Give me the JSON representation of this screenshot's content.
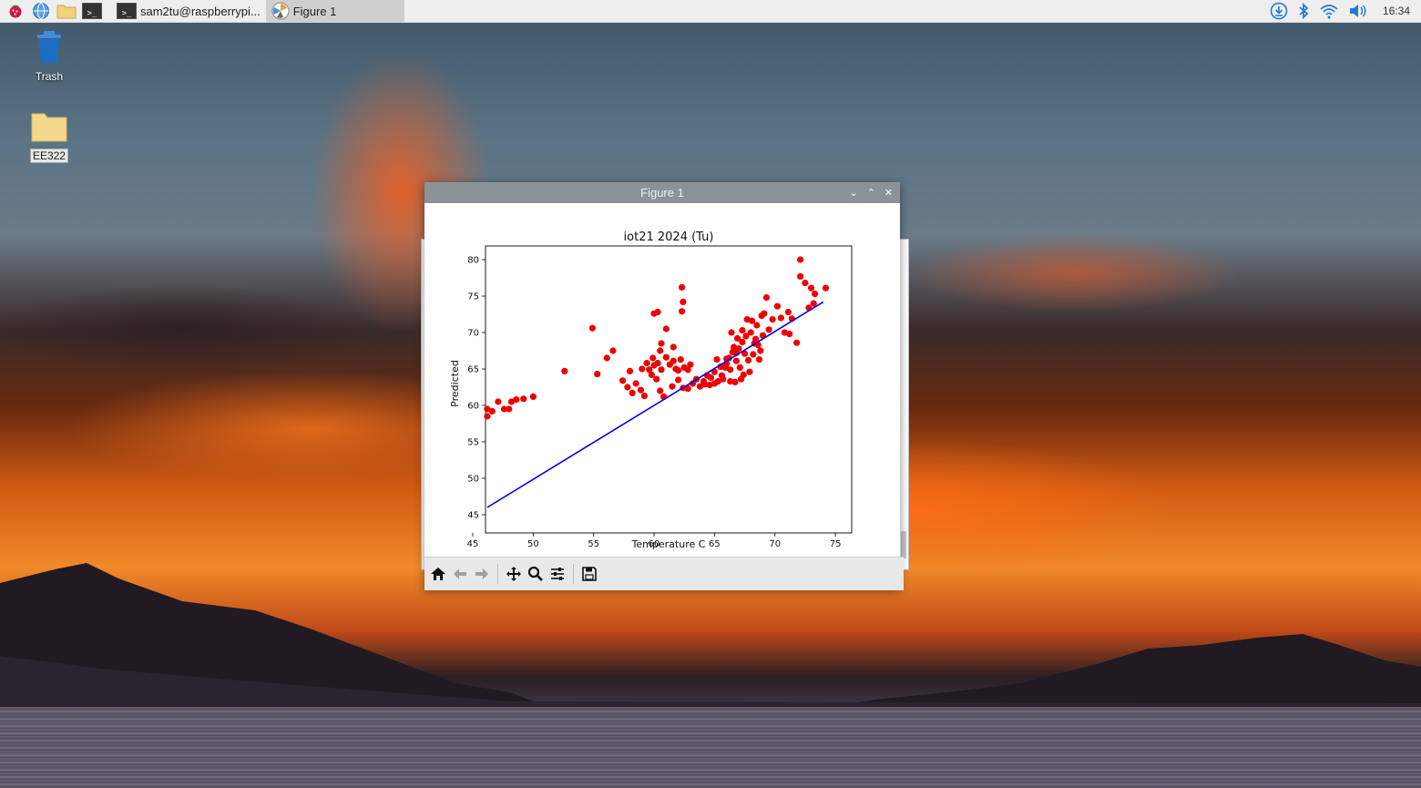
{
  "taskbar": {
    "tasks": [
      {
        "label": "sam2tu@raspberrypi..."
      },
      {
        "label": "Figure 1"
      }
    ],
    "clock": "16:34"
  },
  "desktop": {
    "icons": [
      {
        "label": "Trash"
      },
      {
        "label": "EE322"
      }
    ]
  },
  "window": {
    "title": "Figure 1"
  },
  "toolbar": {
    "buttons": [
      "home-icon",
      "back-arrow-icon",
      "forward-arrow-icon",
      "pan-icon",
      "zoom-icon",
      "configure-icon",
      "save-icon"
    ]
  },
  "colors": {
    "points": "#ee0000",
    "line": "#0000ee",
    "titlebar": "#8b9299"
  },
  "chart_data": {
    "type": "scatter",
    "title": "iot21 2024 (Tu)",
    "xlabel": "Temperature C",
    "ylabel": "Predicted",
    "xlim": [
      45,
      75
    ],
    "ylim": [
      45,
      82
    ],
    "xticks": [
      45,
      50,
      55,
      60,
      65,
      70,
      75
    ],
    "yticks": [
      45,
      50,
      55,
      60,
      65,
      70,
      75,
      80
    ],
    "series": [
      {
        "kind": "scatter",
        "points": [
          [
            46.2,
            58.5
          ],
          [
            46.2,
            59.5
          ],
          [
            46.6,
            59.2
          ],
          [
            47.1,
            60.5
          ],
          [
            47.6,
            59.5
          ],
          [
            48.0,
            59.5
          ],
          [
            48.2,
            60.5
          ],
          [
            48.6,
            60.8
          ],
          [
            49.2,
            60.9
          ],
          [
            50.0,
            61.2
          ],
          [
            52.6,
            64.7
          ],
          [
            54.9,
            70.6
          ],
          [
            55.3,
            64.3
          ],
          [
            56.1,
            66.5
          ],
          [
            56.6,
            67.5
          ],
          [
            57.4,
            63.4
          ],
          [
            57.8,
            62.5
          ],
          [
            58.0,
            64.7
          ],
          [
            58.2,
            61.7
          ],
          [
            58.5,
            63.0
          ],
          [
            58.9,
            62.1
          ],
          [
            59.2,
            61.3
          ],
          [
            59.0,
            65.0
          ],
          [
            59.4,
            65.8
          ],
          [
            59.6,
            64.9
          ],
          [
            59.8,
            64.2
          ],
          [
            60.2,
            63.6
          ],
          [
            60.5,
            62.0
          ],
          [
            60.8,
            61.2
          ],
          [
            59.9,
            66.5
          ],
          [
            60.0,
            65.5
          ],
          [
            60.3,
            65.8
          ],
          [
            60.6,
            64.9
          ],
          [
            61.0,
            66.6
          ],
          [
            61.3,
            65.6
          ],
          [
            61.6,
            66.1
          ],
          [
            61.8,
            65.0
          ],
          [
            62.0,
            64.8
          ],
          [
            62.2,
            66.3
          ],
          [
            62.5,
            65.2
          ],
          [
            62.8,
            64.9
          ],
          [
            63.0,
            65.6
          ],
          [
            60.5,
            67.5
          ],
          [
            60.0,
            72.6
          ],
          [
            60.3,
            72.8
          ],
          [
            60.6,
            68.5
          ],
          [
            61.0,
            70.5
          ],
          [
            61.6,
            68.0
          ],
          [
            62.3,
            72.9
          ],
          [
            62.4,
            74.2
          ],
          [
            62.3,
            76.2
          ],
          [
            61.5,
            62.6
          ],
          [
            62.0,
            63.5
          ],
          [
            62.4,
            62.4
          ],
          [
            62.8,
            62.3
          ],
          [
            63.2,
            63.0
          ],
          [
            63.5,
            63.6
          ],
          [
            63.8,
            62.6
          ],
          [
            64.1,
            63.3
          ],
          [
            64.4,
            64.1
          ],
          [
            64.7,
            63.8
          ],
          [
            65.0,
            64.6
          ],
          [
            65.3,
            63.3
          ],
          [
            65.6,
            64.1
          ],
          [
            65.9,
            65.2
          ],
          [
            65.2,
            66.3
          ],
          [
            65.0,
            63.0
          ],
          [
            64.6,
            62.8
          ],
          [
            66.0,
            65.7
          ],
          [
            66.2,
            66.5
          ],
          [
            66.3,
            64.9
          ],
          [
            66.5,
            67.3
          ],
          [
            66.6,
            68.0
          ],
          [
            66.8,
            66.1
          ],
          [
            67.0,
            67.8
          ],
          [
            67.1,
            65.2
          ],
          [
            67.3,
            68.7
          ],
          [
            67.5,
            67.1
          ],
          [
            67.6,
            69.5
          ],
          [
            67.8,
            66.2
          ],
          [
            68.0,
            70.0
          ],
          [
            67.2,
            63.6
          ],
          [
            66.7,
            63.2
          ],
          [
            66.9,
            69.2
          ],
          [
            66.4,
            70.0
          ],
          [
            67.3,
            70.3
          ],
          [
            67.7,
            71.8
          ],
          [
            68.1,
            71.6
          ],
          [
            68.4,
            69.1
          ],
          [
            68.6,
            68.3
          ],
          [
            68.8,
            67.5
          ],
          [
            69.0,
            69.6
          ],
          [
            68.2,
            67.0
          ],
          [
            68.5,
            71.0
          ],
          [
            68.9,
            72.3
          ],
          [
            69.1,
            72.6
          ],
          [
            69.5,
            70.4
          ],
          [
            69.3,
            74.8
          ],
          [
            69.8,
            71.8
          ],
          [
            70.2,
            73.6
          ],
          [
            70.5,
            72.0
          ],
          [
            70.8,
            70.0
          ],
          [
            71.1,
            72.8
          ],
          [
            71.4,
            71.9
          ],
          [
            71.8,
            68.6
          ],
          [
            72.1,
            80.0
          ],
          [
            72.1,
            77.7
          ],
          [
            72.5,
            76.8
          ],
          [
            73.0,
            76.1
          ],
          [
            73.3,
            75.3
          ],
          [
            73.2,
            74.0
          ],
          [
            74.2,
            76.1
          ],
          [
            72.8,
            73.4
          ],
          [
            71.2,
            69.8
          ],
          [
            65.7,
            63.6
          ],
          [
            66.3,
            63.3
          ],
          [
            64.2,
            62.9
          ],
          [
            67.9,
            64.6
          ],
          [
            68.7,
            66.3
          ],
          [
            65.5,
            65.3
          ],
          [
            66.0,
            66.4
          ],
          [
            67.4,
            64.2
          ],
          [
            66.8,
            67.2
          ],
          [
            68.3,
            68.5
          ]
        ]
      },
      {
        "kind": "line",
        "points": [
          [
            46.2,
            46.0
          ],
          [
            74.0,
            74.2
          ]
        ]
      }
    ]
  }
}
